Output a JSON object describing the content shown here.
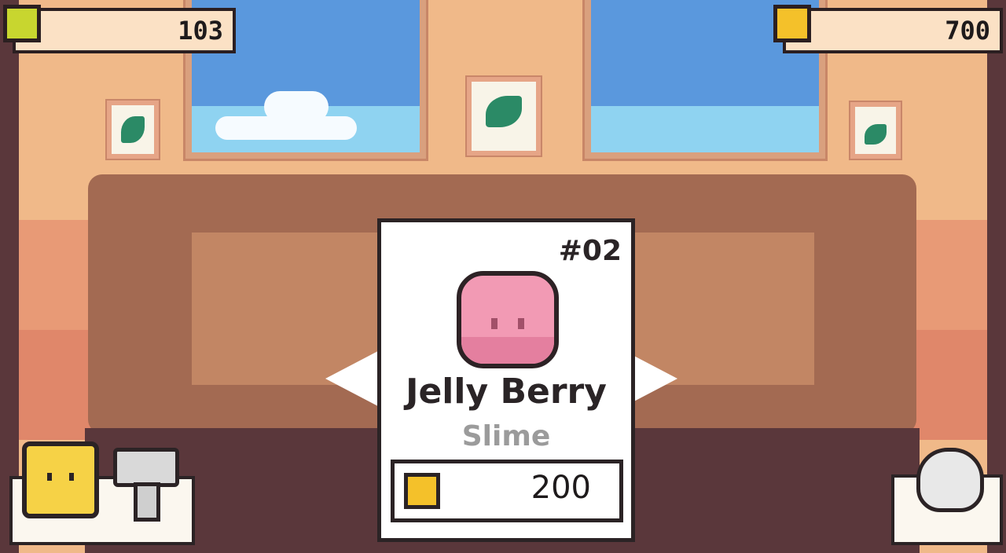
{
  "hud": {
    "left": {
      "icon": "jelly-currency-icon",
      "value": "103"
    },
    "right": {
      "icon": "gold-coin-icon",
      "value": "700"
    }
  },
  "card": {
    "number": "#02",
    "name": "Jelly Berry",
    "type": "Slime",
    "price": "200",
    "price_icon": "gold-coin-icon",
    "creature_icon": "pink-slime-icon"
  },
  "navigation": {
    "prev_icon": "arrow-left-icon",
    "next_icon": "arrow-right-icon"
  },
  "tools": {
    "slime_button_icon": "yellow-slime-icon",
    "hammer_button_icon": "hammer-icon",
    "money_button_icon": "money-bag-icon"
  },
  "colors": {
    "wall": "#f0b989",
    "table": "#a36a52",
    "card_bg": "#ffffff",
    "slime_pink": "#f29ab4",
    "gold": "#f4c12a",
    "jelly_green": "#c8d62f"
  }
}
